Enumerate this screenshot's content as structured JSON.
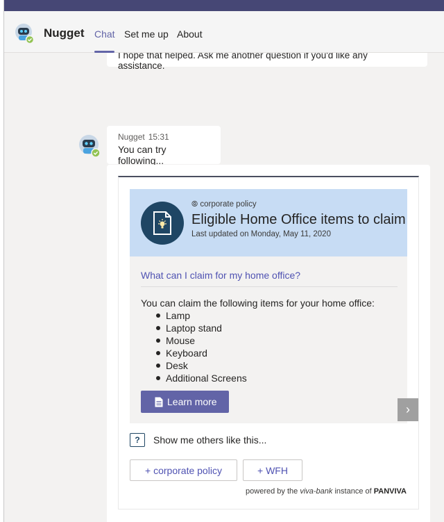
{
  "colors": {
    "accent": "#6264a7",
    "topbar": "#464775",
    "card_header_bg": "#c7dcf4",
    "doc_circle": "#1f4664"
  },
  "header": {
    "app_name": "Nugget",
    "tabs": [
      {
        "label": "Chat",
        "active": true
      },
      {
        "label": "Set me up",
        "active": false
      },
      {
        "label": "About",
        "active": false
      }
    ],
    "avatar_icon": "robot-icon"
  },
  "chat": {
    "previous_message": "I hope that helped. Ask me another question if you'd like any assistance.",
    "message": {
      "sender": "Nugget",
      "time": "15:31",
      "text": "You can try following..."
    }
  },
  "card": {
    "tag": "corporate policy",
    "title": "Eligible Home Office items to claim",
    "updated": "Last updated on Monday, May 11, 2020",
    "question": "What can I claim for my home office?",
    "intro": "You can claim the following items for your home office:",
    "items": [
      "Lamp",
      "Laptop stand",
      "Mouse",
      "Keyboard",
      "Desk",
      "Additional Screens"
    ],
    "learn_more": "Learn more",
    "others_label": "Show me others like this...",
    "chips": [
      "+ corporate policy",
      "+ WFH"
    ],
    "powered": {
      "prefix": "powered by the",
      "instance": "viva-bank",
      "middle": "instance of",
      "brand": "PANVIVA"
    }
  }
}
